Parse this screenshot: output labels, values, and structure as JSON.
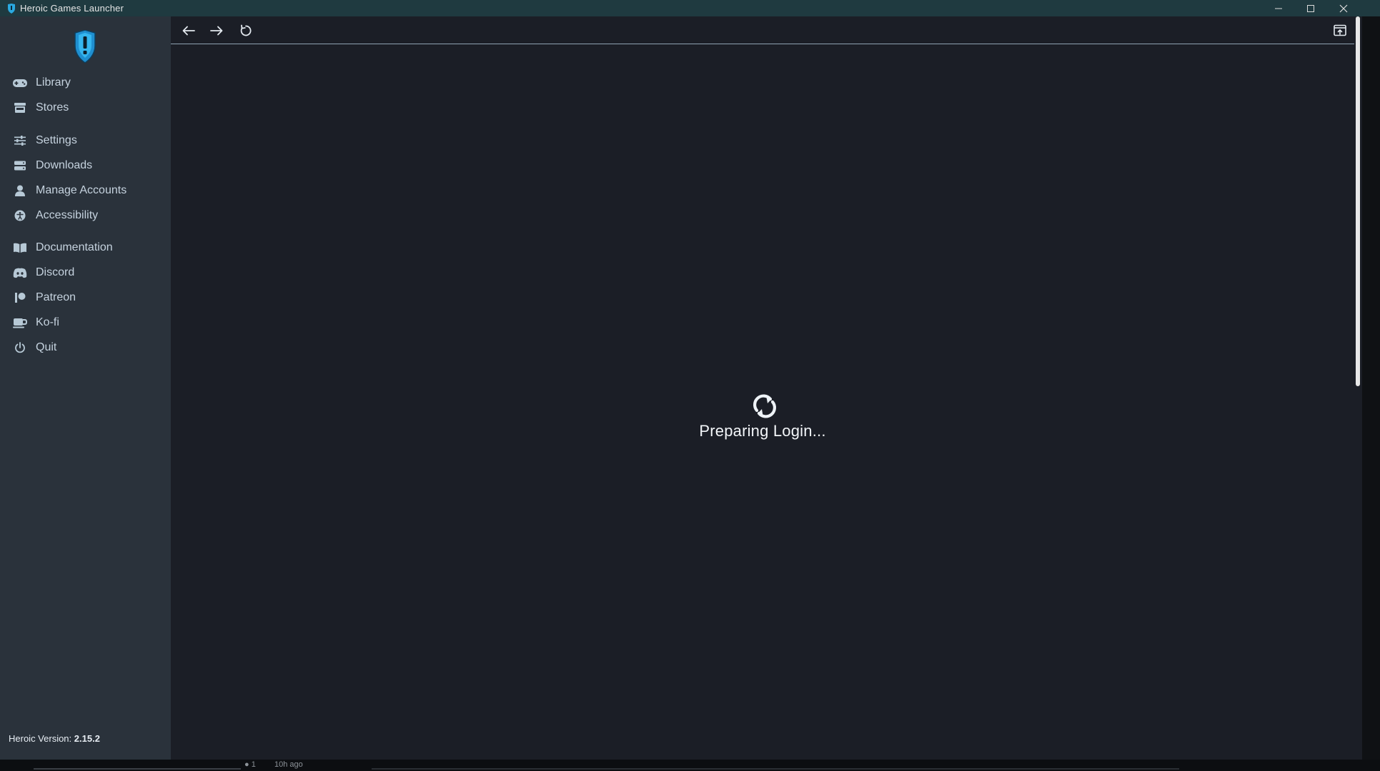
{
  "window": {
    "title": "Heroic Games Launcher"
  },
  "sidebar": {
    "items": [
      {
        "label": "Library",
        "icon": "gamepad-icon"
      },
      {
        "label": "Stores",
        "icon": "store-icon"
      },
      {
        "label": "Settings",
        "icon": "sliders-icon"
      },
      {
        "label": "Downloads",
        "icon": "downloads-icon"
      },
      {
        "label": "Manage Accounts",
        "icon": "user-icon"
      },
      {
        "label": "Accessibility",
        "icon": "accessibility-icon"
      },
      {
        "label": "Documentation",
        "icon": "book-icon"
      },
      {
        "label": "Discord",
        "icon": "discord-icon"
      },
      {
        "label": "Patreon",
        "icon": "patreon-icon"
      },
      {
        "label": "Ko-fi",
        "icon": "coffee-icon"
      },
      {
        "label": "Quit",
        "icon": "power-icon"
      }
    ],
    "version_label": "Heroic Version:",
    "version_value": "2.15.2"
  },
  "main": {
    "loading_text": "Preparing Login..."
  },
  "taskbar": {
    "count": "1",
    "time_ago": "10h ago"
  },
  "colors": {
    "sidebar_bg": "#2a323b",
    "main_bg": "#1b1e26",
    "titlebar_bg": "#1f3a40",
    "accent": "#2aa9e0"
  }
}
